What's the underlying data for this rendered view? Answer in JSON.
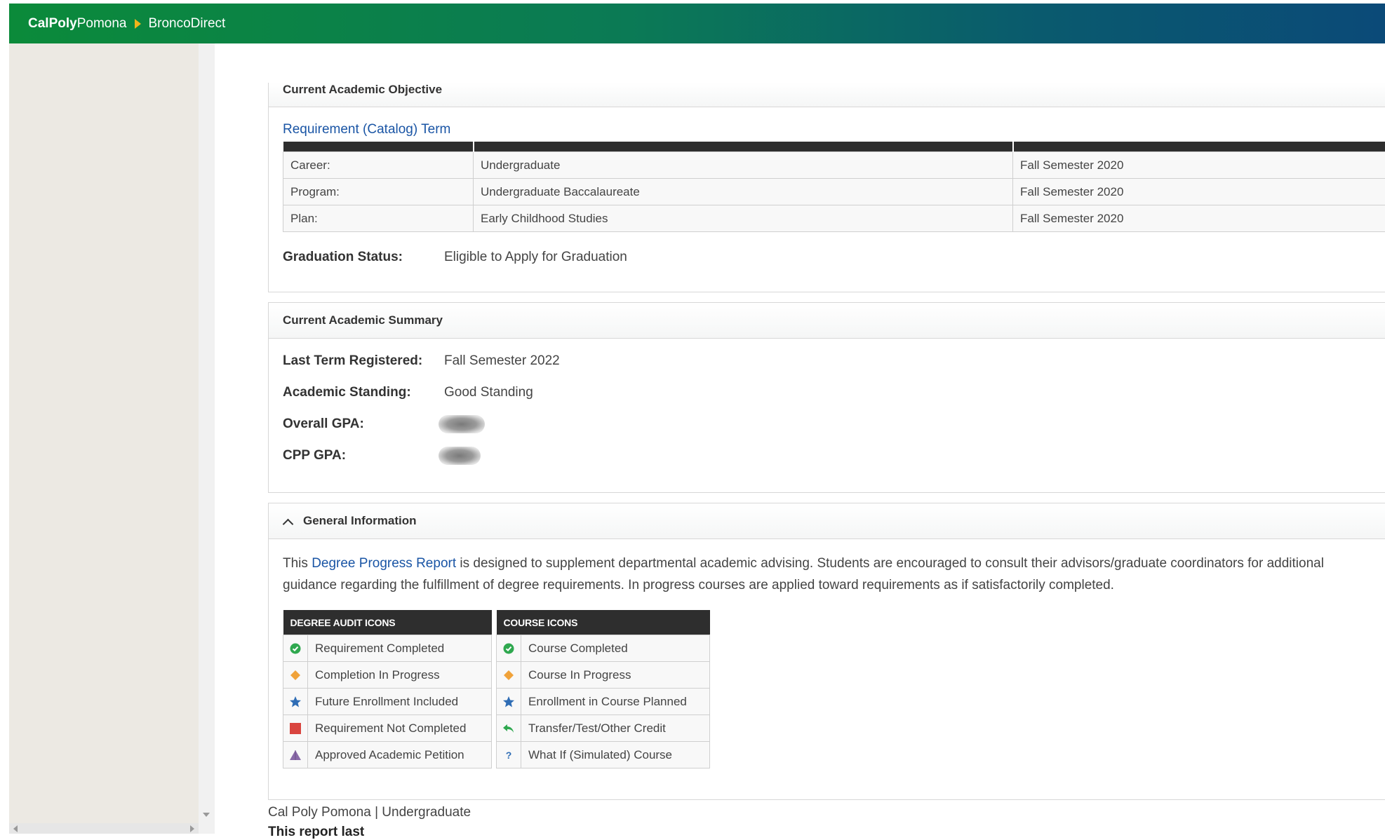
{
  "header": {
    "brand_bold": "CalPoly",
    "brand_light": "Pomona",
    "app_name": "BroncoDirect"
  },
  "objective": {
    "title": "Current Academic Objective",
    "subtitle": "Requirement (Catalog) Term",
    "rows": [
      {
        "label": "Career:",
        "value": "Undergraduate",
        "term": "Fall Semester 2020"
      },
      {
        "label": "Program:",
        "value": "Undergraduate Baccalaureate",
        "term": "Fall Semester 2020"
      },
      {
        "label": "Plan:",
        "value": "Early Childhood Studies",
        "term": "Fall Semester 2020"
      }
    ],
    "graduation_label": "Graduation Status:",
    "graduation_value": "Eligible to Apply for Graduation"
  },
  "summary": {
    "title": "Current Academic Summary",
    "last_term_label": "Last Term Registered:",
    "last_term_value": "Fall Semester 2022",
    "standing_label": "Academic Standing:",
    "standing_value": "Good Standing",
    "overall_gpa_label": "Overall GPA:",
    "cpp_gpa_label": "CPP GPA:"
  },
  "general": {
    "title": "General Information",
    "text_before": "This ",
    "link_text": "Degree Progress Report",
    "text_after": " is designed to supplement departmental academic advising. Students are encouraged to consult their advisors/graduate coordinators for additional guidance regarding the fulfillment of degree requirements. In progress courses are applied toward requirements as if satisfactorily completed.",
    "audit_header": "DEGREE AUDIT ICONS",
    "audit_items": [
      {
        "icon": "check-circle-icon",
        "label": "Requirement Completed"
      },
      {
        "icon": "diamond-icon",
        "label": "Completion In Progress"
      },
      {
        "icon": "star-icon",
        "label": "Future Enrollment Included"
      },
      {
        "icon": "square-icon",
        "label": "Requirement Not Completed"
      },
      {
        "icon": "triangle-icon",
        "label": "Approved Academic Petition"
      }
    ],
    "course_header": "COURSE ICONS",
    "course_items": [
      {
        "icon": "check-circle-icon",
        "label": "Course Completed"
      },
      {
        "icon": "diamond-icon",
        "label": "Course In Progress"
      },
      {
        "icon": "star-icon",
        "label": "Enrollment in Course Planned"
      },
      {
        "icon": "reply-arrow-icon",
        "label": "Transfer/Test/Other Credit"
      },
      {
        "icon": "question-icon",
        "label": "What If (Simulated) Course",
        "glyph": "?"
      }
    ]
  },
  "footer": {
    "line1": "Cal Poly Pomona | Undergraduate",
    "line2": "This report last"
  },
  "colors": {
    "green": "#2fa84f",
    "orange": "#f0a23a",
    "blue": "#2f6db5",
    "red": "#d9453f",
    "purple": "#8a6aa8",
    "link": "#1a55a5"
  }
}
